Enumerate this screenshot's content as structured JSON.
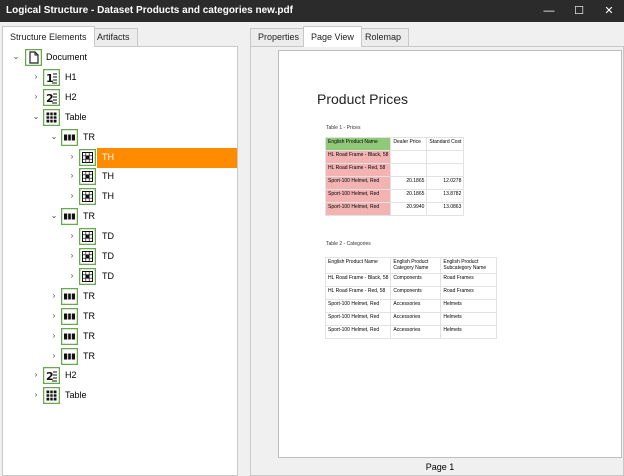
{
  "window": {
    "title": "Logical Structure - Dataset Products and categories new.pdf",
    "min_glyph": "—",
    "max_glyph": "☐",
    "close_glyph": "✕"
  },
  "left_tabs": [
    {
      "label": "Structure Elements",
      "active": true
    },
    {
      "label": "Artifacts",
      "active": false
    }
  ],
  "right_tabs": [
    {
      "label": "Properties",
      "active": false
    },
    {
      "label": "Page View",
      "active": true
    },
    {
      "label": "Rolemap",
      "active": false
    }
  ],
  "tree": [
    {
      "label": "Document",
      "icon": "document-icon",
      "depth": 0,
      "expanded": true
    },
    {
      "label": "H1",
      "icon": "heading-1-icon",
      "depth": 1,
      "expanded": false
    },
    {
      "label": "H2",
      "icon": "heading-2-icon",
      "depth": 1,
      "expanded": false
    },
    {
      "label": "Table",
      "icon": "table-icon",
      "depth": 1,
      "expanded": true
    },
    {
      "label": "TR",
      "icon": "table-row-icon",
      "depth": 2,
      "expanded": true
    },
    {
      "label": "TH",
      "icon": "table-cell-icon",
      "depth": 3,
      "expanded": false,
      "selected": true
    },
    {
      "label": "TH",
      "icon": "table-cell-icon",
      "depth": 3,
      "expanded": false
    },
    {
      "label": "TH",
      "icon": "table-cell-icon",
      "depth": 3,
      "expanded": false
    },
    {
      "label": "TR",
      "icon": "table-row-icon",
      "depth": 2,
      "expanded": true
    },
    {
      "label": "TD",
      "icon": "table-cell-icon",
      "depth": 3,
      "expanded": false
    },
    {
      "label": "TD",
      "icon": "table-cell-icon",
      "depth": 3,
      "expanded": false
    },
    {
      "label": "TD",
      "icon": "table-cell-icon",
      "depth": 3,
      "expanded": false
    },
    {
      "label": "TR",
      "icon": "table-row-icon",
      "depth": 2,
      "expanded": false
    },
    {
      "label": "TR",
      "icon": "table-row-icon",
      "depth": 2,
      "expanded": false
    },
    {
      "label": "TR",
      "icon": "table-row-icon",
      "depth": 2,
      "expanded": false
    },
    {
      "label": "TR",
      "icon": "table-row-icon",
      "depth": 2,
      "expanded": false
    },
    {
      "label": "H2",
      "icon": "heading-2-icon",
      "depth": 1,
      "expanded": false
    },
    {
      "label": "Table",
      "icon": "table-icon",
      "depth": 1,
      "expanded": false
    }
  ],
  "colors": {
    "icon_border": "#6aa84f",
    "selection": "#ff8c00",
    "highlight_green": "#90c978",
    "highlight_red": "#f3b3b3"
  },
  "page": {
    "title": "Product Prices",
    "table1_caption": "Table 1 - Prices",
    "table1": {
      "headers": [
        "English Product Name",
        "Dealer Price",
        "Standard Cost"
      ],
      "rows": [
        [
          "HL Road Frame - Black, 58",
          "",
          ""
        ],
        [
          "HL Road Frame - Red, 58",
          "",
          ""
        ],
        [
          "Sport-100 Helmet, Red",
          "20.1865",
          "12.0278"
        ],
        [
          "Sport-100 Helmet, Red",
          "20.1865",
          "13.8782"
        ],
        [
          "Sport-100 Helmet, Red",
          "20.9940",
          "13.0863"
        ]
      ]
    },
    "table2_caption": "Table 2 - Categories",
    "table2": {
      "headers": [
        "English Product Name",
        "English Product Category Name",
        "English Product Subcategory Name"
      ],
      "rows": [
        [
          "HL Road Frame - Black, 58",
          "Components",
          "Road Frames"
        ],
        [
          "HL Road Frame - Red, 58",
          "Components",
          "Road Frames"
        ],
        [
          "Sport-100 Helmet, Red",
          "Accessories",
          "Helmets"
        ],
        [
          "Sport-100 Helmet, Red",
          "Accessories",
          "Helmets"
        ],
        [
          "Sport-100 Helmet, Red",
          "Accessories",
          "Helmets"
        ]
      ]
    },
    "page_label": "Page 1"
  }
}
